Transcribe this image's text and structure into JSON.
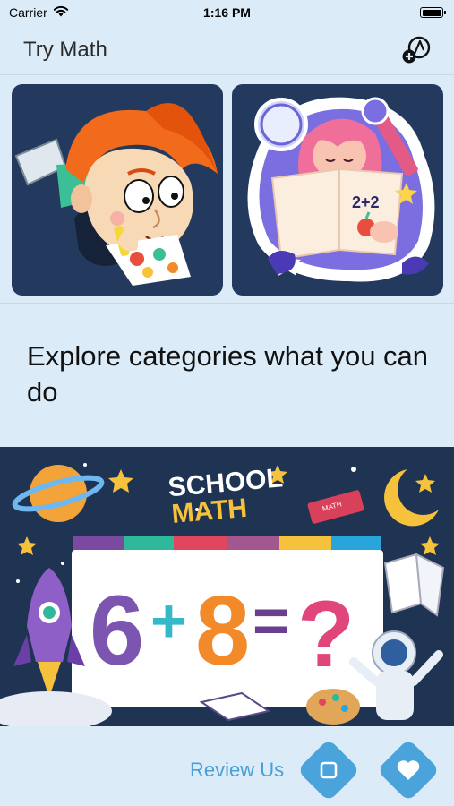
{
  "status_bar": {
    "carrier": "Carrier",
    "time": "1:16 PM"
  },
  "header": {
    "title": "Try Math",
    "action_icon": "add-drawing-icon"
  },
  "cards": [
    {
      "name": "boy-drawing-illustration"
    },
    {
      "name": "girl-reading-illustration",
      "text": "2+2"
    }
  ],
  "explore_text": "Explore categories what you can do",
  "banner": {
    "title_line1": "SCHOOL",
    "title_line2": "MATH",
    "equation": {
      "a": "6",
      "op1": "+",
      "b": "8",
      "op2": "=",
      "result": "?"
    },
    "book_label": "MATH"
  },
  "bottom_bar": {
    "review_label": "Review Us",
    "stop_icon": "square-icon",
    "favorite_icon": "heart-icon"
  },
  "colors": {
    "background": "#dcebf8",
    "accent": "#4aa3db",
    "card_bg": "#233a5e"
  }
}
